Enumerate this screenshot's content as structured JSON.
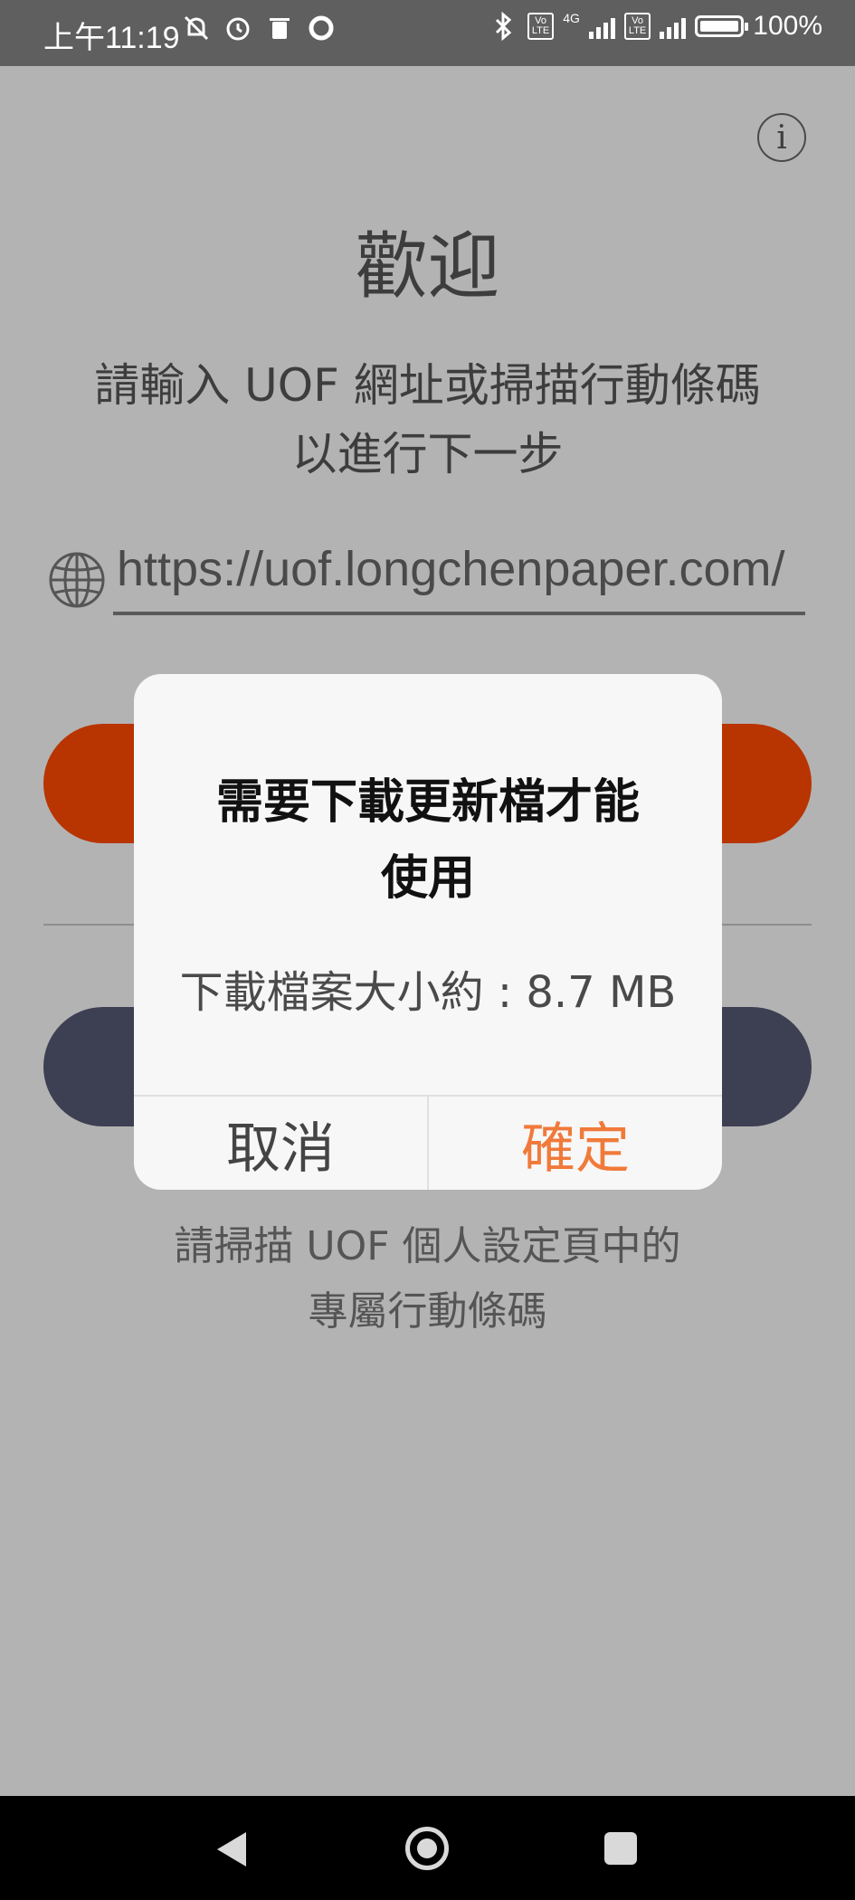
{
  "status_bar": {
    "time": "上午11:19",
    "network": "4G",
    "battery": "100%"
  },
  "main": {
    "info_icon": "i",
    "title": "歡迎",
    "instruction_line1": "請輸入 UOF 網址或掃描行動條碼",
    "instruction_line2": "以進行下一步",
    "url_value": "https://uof.longchenpaper.com/",
    "scan_hint_line1": "請掃描 UOF 個人設定頁中的",
    "scan_hint_line2": "專屬行動條碼"
  },
  "dialog": {
    "title_line1": "需要下載更新檔才能",
    "title_line2": "使用",
    "message": "下載檔案大小約 : 8.7 MB",
    "cancel_label": "取消",
    "confirm_label": "確定"
  },
  "colors": {
    "primary_button": "#b83400",
    "secondary_button": "#3d3f53",
    "confirm_text": "#f07a3a",
    "overlay": "#b3b3b3"
  }
}
